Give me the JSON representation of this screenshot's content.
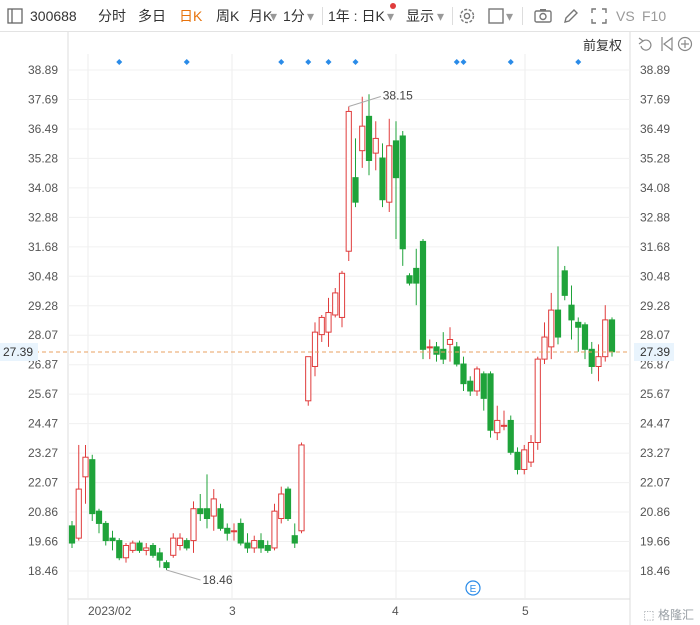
{
  "toolbar": {
    "code": "300688",
    "periods": [
      "分时",
      "多日",
      "日K",
      "周K",
      "月K",
      "1分"
    ],
    "active_period": "日K",
    "range_select": "1年 : 日K",
    "display_label": "显示",
    "vs_label": "VS",
    "f10_label": "F10"
  },
  "adjust_label": "前复权",
  "price_label": "27.39",
  "annotations": {
    "high": "38.15",
    "low": "18.46"
  },
  "event_marker": "E",
  "watermark": "格隆汇",
  "colors": {
    "up": "#e03c3c",
    "down": "#1fa33a",
    "price_line": "#e8a060",
    "marker": "#2a8be8",
    "accent": "#e8730c"
  },
  "chart_data": {
    "type": "candlestick",
    "y_ticks": [
      "38.89",
      "37.69",
      "36.49",
      "35.28",
      "34.08",
      "32.88",
      "31.68",
      "30.48",
      "29.28",
      "28.07",
      "26.87",
      "25.67",
      "24.47",
      "23.27",
      "22.07",
      "20.86",
      "19.66",
      "18.46"
    ],
    "ylim": [
      18.46,
      38.89
    ],
    "x_labels": [
      "2023/02",
      "3",
      "4",
      "5"
    ],
    "current_price": 27.39,
    "candles": [
      [
        20.3,
        19.6,
        20.5,
        19.4
      ],
      [
        19.8,
        21.8,
        23.6,
        19.7
      ],
      [
        22.3,
        23.1,
        23.6,
        21.2
      ],
      [
        23.0,
        20.8,
        23.2,
        20.5
      ],
      [
        20.9,
        20.4,
        21.0,
        20.0
      ],
      [
        20.4,
        19.7,
        20.5,
        19.5
      ],
      [
        19.8,
        19.7,
        20.1,
        19.3
      ],
      [
        19.7,
        19.0,
        19.8,
        18.9
      ],
      [
        19.0,
        19.5,
        19.6,
        18.8
      ],
      [
        19.3,
        19.6,
        19.7,
        19.2
      ],
      [
        19.6,
        19.3,
        19.7,
        19.2
      ],
      [
        19.3,
        19.4,
        19.6,
        19.1
      ],
      [
        19.5,
        19.1,
        19.6,
        19.0
      ],
      [
        19.2,
        18.9,
        19.4,
        18.6
      ],
      [
        18.8,
        18.6,
        18.9,
        18.5
      ],
      [
        19.1,
        19.8,
        20.0,
        19.0
      ],
      [
        19.5,
        19.8,
        20.0,
        19.3
      ],
      [
        19.7,
        19.4,
        19.8,
        19.3
      ],
      [
        19.7,
        21.0,
        21.3,
        19.2
      ],
      [
        21.0,
        20.8,
        21.6,
        20.5
      ],
      [
        21.0,
        20.6,
        22.4,
        20.2
      ],
      [
        20.7,
        21.4,
        21.8,
        20.1
      ],
      [
        21.0,
        20.2,
        21.2,
        20.1
      ],
      [
        20.2,
        20.0,
        20.4,
        19.7
      ],
      [
        20.1,
        20.1,
        20.4,
        19.7
      ],
      [
        20.4,
        19.6,
        20.6,
        19.5
      ],
      [
        19.6,
        19.4,
        20.0,
        19.2
      ],
      [
        19.4,
        19.7,
        19.9,
        19.2
      ],
      [
        19.7,
        19.4,
        20.0,
        19.2
      ],
      [
        19.5,
        19.3,
        19.7,
        19.2
      ],
      [
        19.4,
        20.9,
        21.2,
        19.3
      ],
      [
        20.6,
        21.6,
        21.9,
        20.4
      ],
      [
        21.8,
        20.6,
        21.9,
        20.5
      ],
      [
        19.9,
        19.6,
        20.4,
        19.4
      ],
      [
        20.1,
        23.6,
        23.7,
        20.0
      ],
      [
        25.4,
        27.2,
        27.2,
        25.2
      ],
      [
        26.8,
        28.2,
        28.6,
        26.4
      ],
      [
        28.1,
        28.8,
        28.9,
        27.8
      ],
      [
        28.2,
        29.0,
        29.6,
        27.6
      ],
      [
        28.9,
        29.8,
        30.0,
        28.8
      ],
      [
        28.8,
        30.6,
        30.7,
        28.4
      ],
      [
        31.5,
        37.2,
        37.4,
        31.1
      ],
      [
        34.5,
        33.5,
        36.1,
        33.3
      ],
      [
        35.6,
        36.6,
        37.8,
        34.9
      ],
      [
        37.0,
        35.2,
        37.9,
        34.6
      ],
      [
        35.5,
        36.1,
        36.8,
        34.8
      ],
      [
        35.3,
        33.6,
        35.9,
        33.3
      ],
      [
        33.5,
        35.8,
        36.9,
        33.1
      ],
      [
        36.0,
        34.5,
        36.8,
        32.0
      ],
      [
        36.2,
        31.6,
        36.4,
        30.9
      ],
      [
        30.5,
        30.2,
        30.6,
        30.1
      ],
      [
        30.8,
        30.2,
        31.6,
        29.3
      ],
      [
        31.9,
        27.5,
        32.0,
        27.1
      ],
      [
        27.6,
        27.6,
        27.9,
        27.1
      ],
      [
        27.6,
        27.3,
        27.8,
        27.0
      ],
      [
        27.5,
        27.1,
        28.2,
        26.9
      ],
      [
        27.7,
        27.9,
        28.4,
        27.0
      ],
      [
        27.6,
        26.9,
        27.8,
        26.8
      ],
      [
        26.9,
        26.1,
        27.2,
        25.8
      ],
      [
        26.2,
        25.8,
        26.4,
        25.6
      ],
      [
        25.8,
        26.7,
        26.8,
        25.6
      ],
      [
        26.5,
        25.5,
        26.6,
        25.0
      ],
      [
        26.5,
        24.2,
        26.6,
        23.9
      ],
      [
        24.1,
        24.6,
        25.2,
        23.8
      ],
      [
        24.4,
        24.4,
        25.0,
        24.2
      ],
      [
        24.6,
        23.3,
        24.8,
        23.2
      ],
      [
        23.3,
        22.6,
        23.5,
        22.4
      ],
      [
        22.6,
        23.4,
        23.6,
        22.4
      ],
      [
        22.9,
        23.7,
        24.0,
        22.7
      ],
      [
        23.7,
        27.1,
        27.2,
        23.4
      ],
      [
        27.1,
        28.0,
        28.6,
        26.9
      ],
      [
        27.6,
        29.1,
        29.8,
        27.1
      ],
      [
        29.1,
        28.0,
        31.7,
        27.7
      ],
      [
        30.7,
        29.7,
        30.9,
        29.5
      ],
      [
        29.3,
        28.7,
        30.1,
        27.9
      ],
      [
        28.6,
        28.4,
        28.8,
        27.4
      ],
      [
        28.5,
        27.5,
        28.6,
        27.1
      ],
      [
        27.5,
        26.8,
        27.8,
        26.5
      ],
      [
        26.8,
        27.2,
        27.7,
        26.2
      ],
      [
        27.2,
        28.7,
        29.3,
        27.0
      ],
      [
        28.7,
        27.4,
        28.8,
        27.2
      ]
    ],
    "marker_bars": [
      7,
      17,
      31,
      35,
      38,
      42,
      57,
      58,
      65,
      75
    ],
    "high_bar": 41,
    "low_bar": 14
  }
}
